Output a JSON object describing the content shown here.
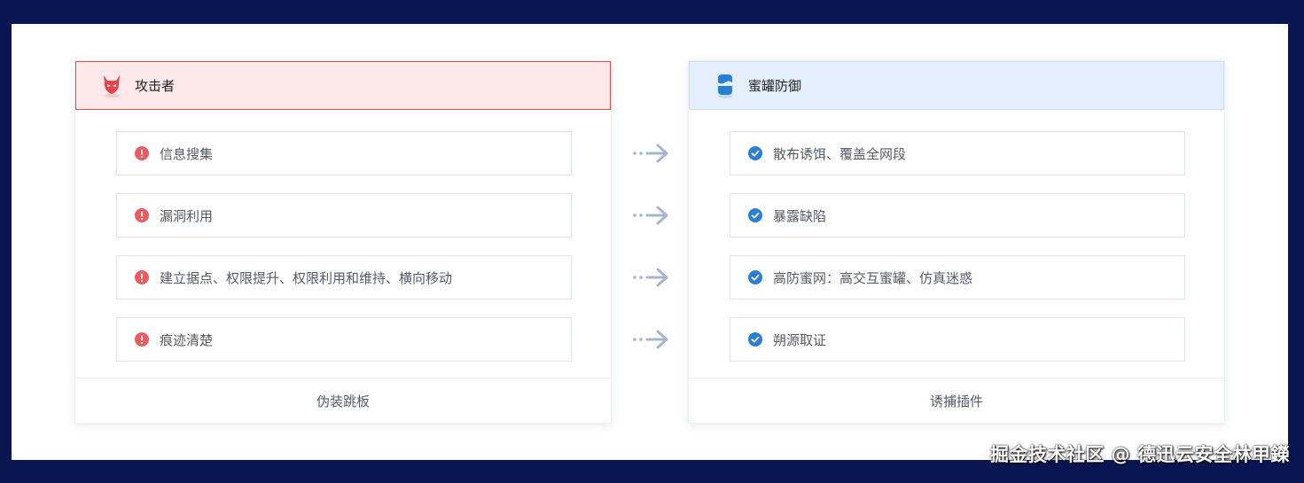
{
  "attacker": {
    "title": "攻击者",
    "items": [
      {
        "label": "信息搜集"
      },
      {
        "label": "漏洞利用"
      },
      {
        "label": "建立据点、权限提升、权限利用和维持、横向移动"
      },
      {
        "label": "痕迹清楚"
      }
    ],
    "footer": "伪装跳板"
  },
  "defense": {
    "title": "蜜罐防御",
    "items": [
      {
        "label": "散布诱饵、覆盖全网段"
      },
      {
        "label": "暴露缺陷"
      },
      {
        "label": "高防蜜网：高交互蜜罐、仿真迷惑"
      },
      {
        "label": "朔源取证"
      }
    ],
    "footer": "诱捕插件"
  },
  "watermark": "掘金技术社区 @ 德迅云安全林甲鑅",
  "colors": {
    "attacker_accent": "#e0474f",
    "defense_accent": "#2a7fd4",
    "arrow": "#aab4cf",
    "background": "#0a1652"
  },
  "icons": {
    "attacker_header": "devil-mask-icon",
    "defense_header": "honeypot-jar-icon",
    "attacker_item": "exclamation-circle-icon",
    "defense_item": "check-circle-icon",
    "connector": "dotted-arrow-right-icon"
  }
}
